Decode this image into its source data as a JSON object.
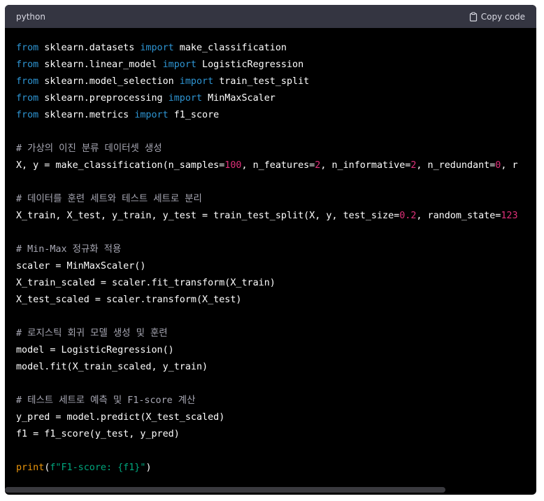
{
  "header": {
    "language": "python",
    "copy_label": "Copy code",
    "copy_icon": "clipboard-icon"
  },
  "code_lines": [
    [
      [
        "kw",
        "from"
      ],
      [
        "plain",
        " sklearn.datasets "
      ],
      [
        "kw",
        "import"
      ],
      [
        "plain",
        " make_classification"
      ]
    ],
    [
      [
        "kw",
        "from"
      ],
      [
        "plain",
        " sklearn.linear_model "
      ],
      [
        "kw",
        "import"
      ],
      [
        "plain",
        " LogisticRegression"
      ]
    ],
    [
      [
        "kw",
        "from"
      ],
      [
        "plain",
        " sklearn.model_selection "
      ],
      [
        "kw",
        "import"
      ],
      [
        "plain",
        " train_test_split"
      ]
    ],
    [
      [
        "kw",
        "from"
      ],
      [
        "plain",
        " sklearn.preprocessing "
      ],
      [
        "kw",
        "import"
      ],
      [
        "plain",
        " MinMaxScaler"
      ]
    ],
    [
      [
        "kw",
        "from"
      ],
      [
        "plain",
        " sklearn.metrics "
      ],
      [
        "kw",
        "import"
      ],
      [
        "plain",
        " f1_score"
      ]
    ],
    [],
    [
      [
        "comment",
        "# 가상의 이진 분류 데이터셋 생성"
      ]
    ],
    [
      [
        "plain",
        "X, y = make_classification(n_samples="
      ],
      [
        "num",
        "100"
      ],
      [
        "plain",
        ", n_features="
      ],
      [
        "num",
        "2"
      ],
      [
        "plain",
        ", n_informative="
      ],
      [
        "num",
        "2"
      ],
      [
        "plain",
        ", n_redundant="
      ],
      [
        "num",
        "0"
      ],
      [
        "plain",
        ", r"
      ]
    ],
    [],
    [
      [
        "comment",
        "# 데이터를 훈련 세트와 테스트 세트로 분리"
      ]
    ],
    [
      [
        "plain",
        "X_train, X_test, y_train, y_test = train_test_split(X, y, test_size="
      ],
      [
        "num",
        "0.2"
      ],
      [
        "plain",
        ", random_state="
      ],
      [
        "num",
        "123"
      ]
    ],
    [],
    [
      [
        "comment",
        "# Min-Max 정규화 적용"
      ]
    ],
    [
      [
        "plain",
        "scaler = MinMaxScaler()"
      ]
    ],
    [
      [
        "plain",
        "X_train_scaled = scaler.fit_transform(X_train)"
      ]
    ],
    [
      [
        "plain",
        "X_test_scaled = scaler.transform(X_test)"
      ]
    ],
    [],
    [
      [
        "comment",
        "# 로지스틱 회귀 모델 생성 및 훈련"
      ]
    ],
    [
      [
        "plain",
        "model = LogisticRegression()"
      ]
    ],
    [
      [
        "plain",
        "model.fit(X_train_scaled, y_train)"
      ]
    ],
    [],
    [
      [
        "comment",
        "# 테스트 세트로 예측 및 F1-score 계산"
      ]
    ],
    [
      [
        "plain",
        "y_pred = model.predict(X_test_scaled)"
      ]
    ],
    [
      [
        "plain",
        "f1 = f1_score(y_test, y_pred)"
      ]
    ],
    [],
    [
      [
        "fn",
        "print"
      ],
      [
        "punct",
        "("
      ],
      [
        "str",
        "f\"F1-score: {f1}\""
      ],
      [
        "punct",
        ")"
      ]
    ]
  ],
  "colors": {
    "background": "#000000",
    "header_background": "#343541",
    "keyword": "#2e95d3",
    "number": "#df3079",
    "comment": "#a8a8b4",
    "function": "#e9950c",
    "string": "#00a67d",
    "text": "#ffffff"
  }
}
